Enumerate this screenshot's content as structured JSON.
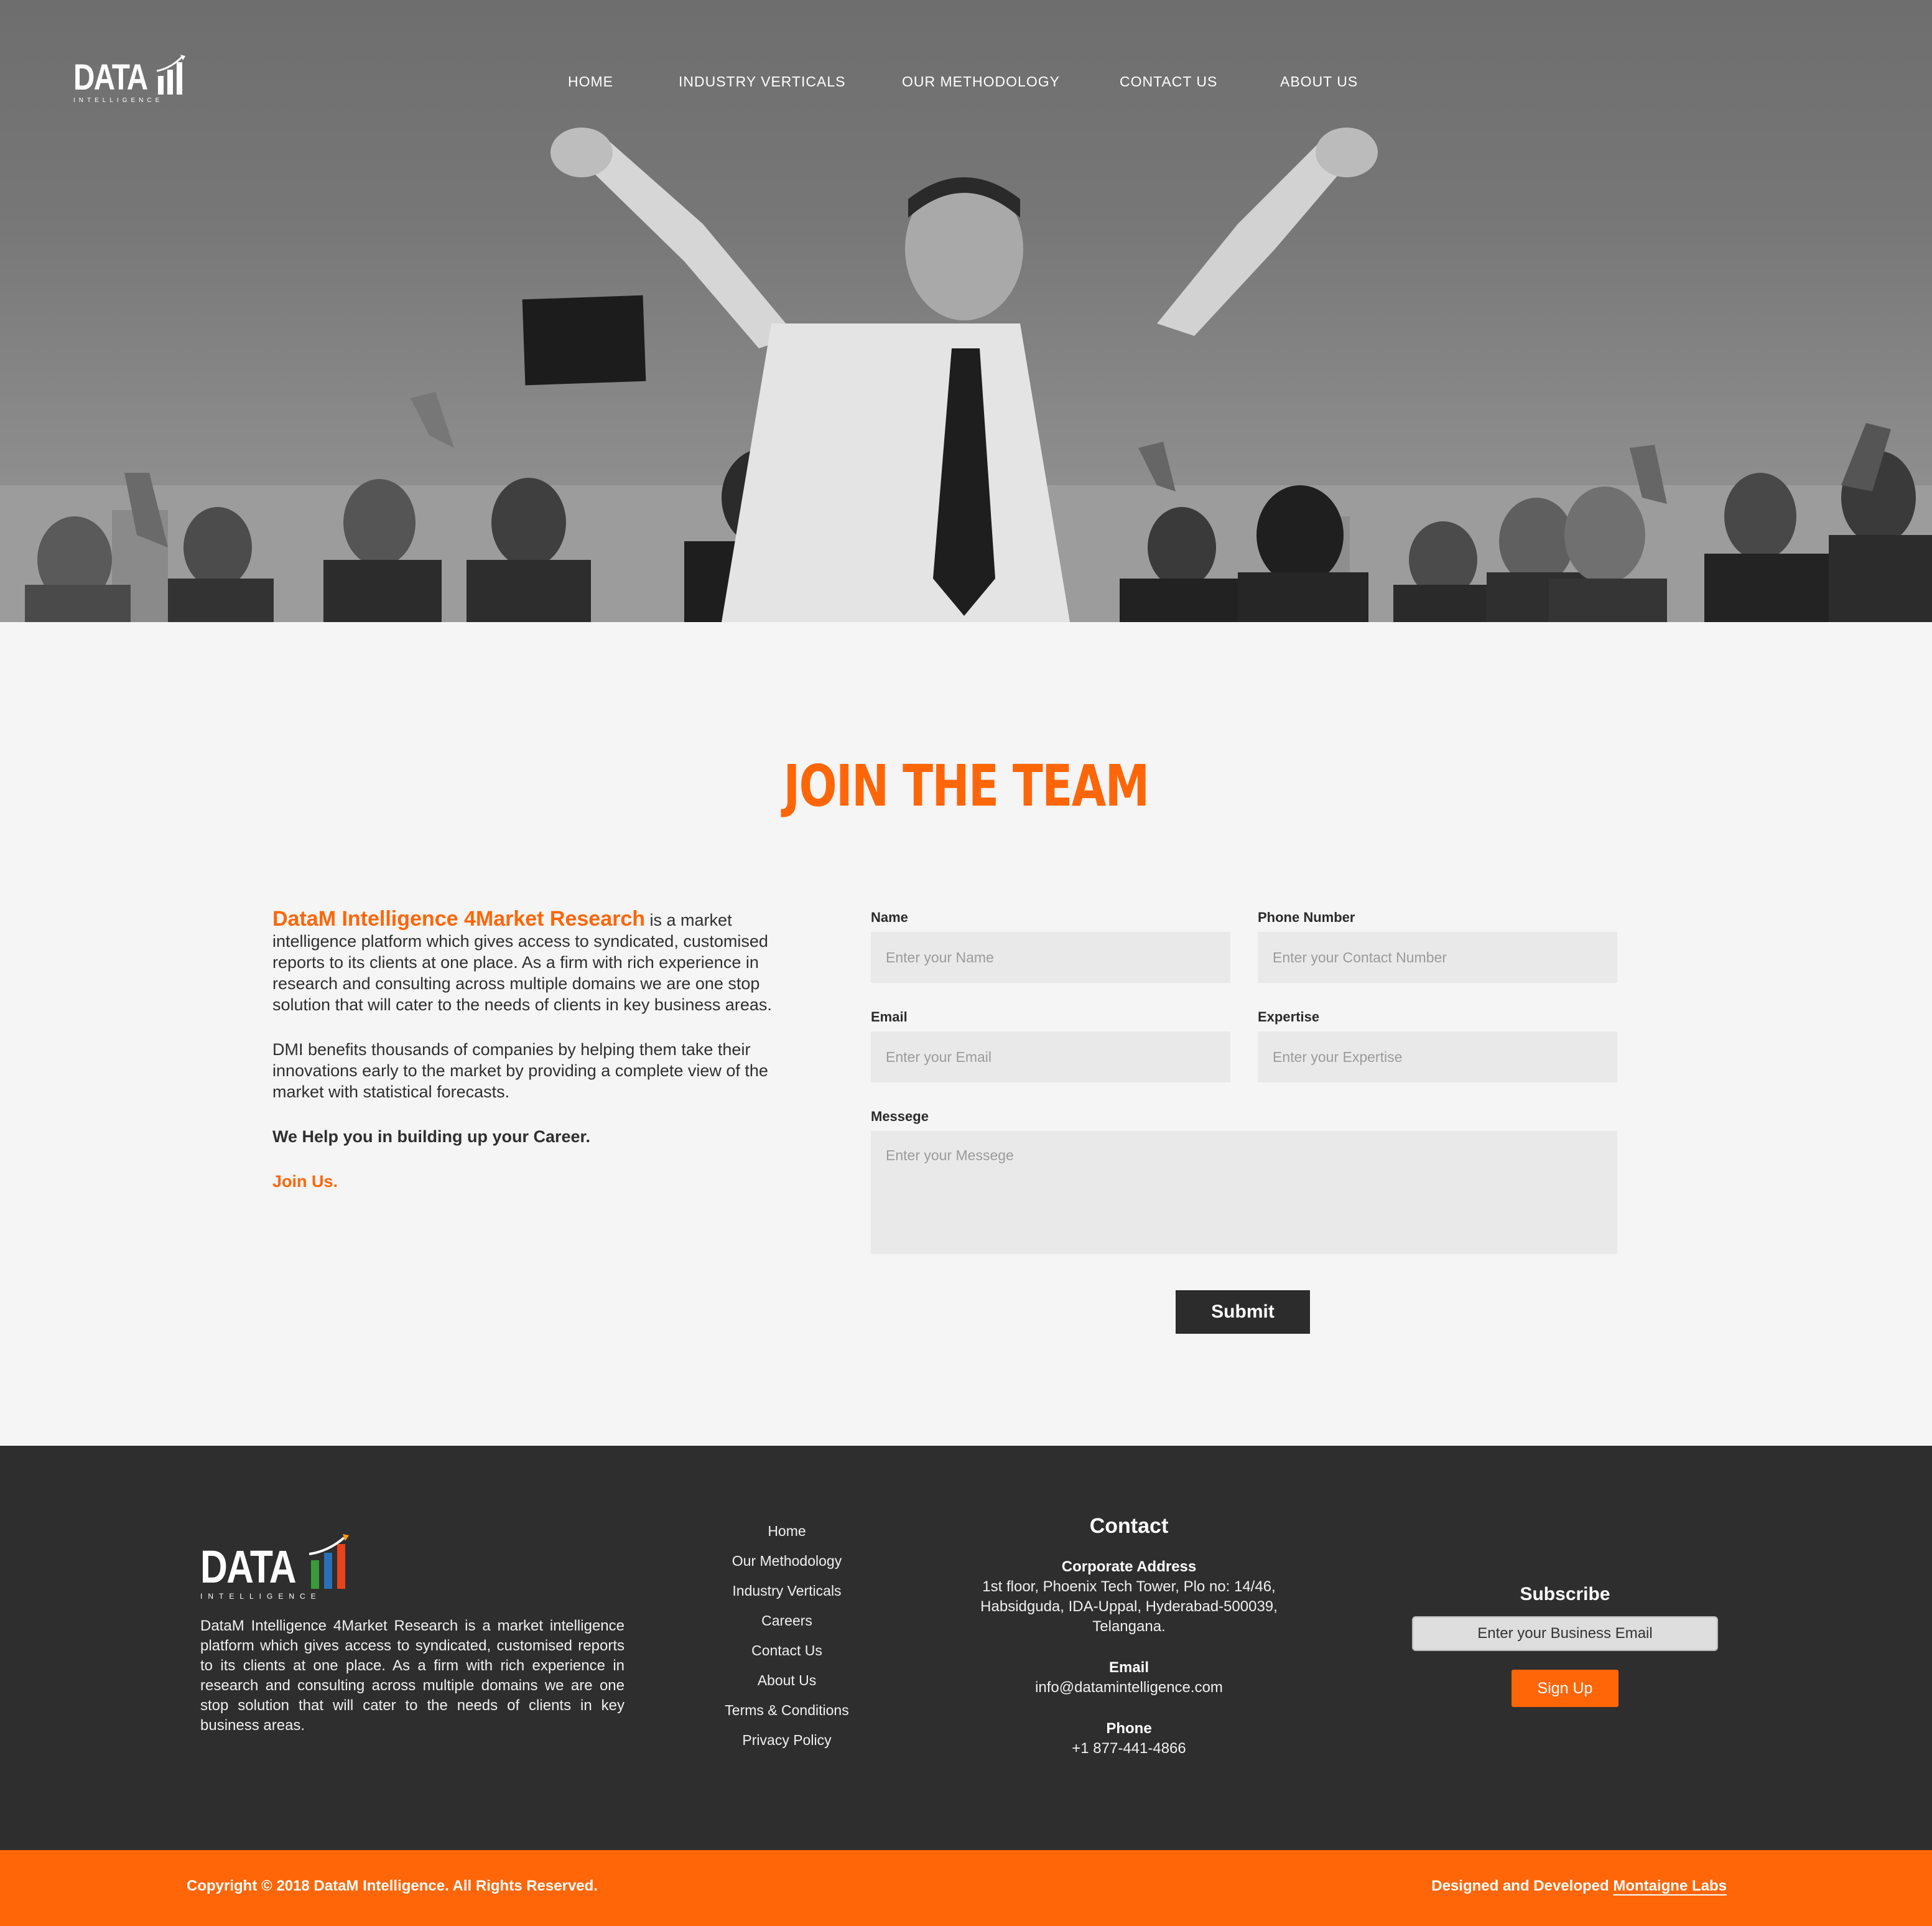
{
  "brand": {
    "logo_word": "DATA",
    "logo_sub": "INTELLIGENCE",
    "accent_color": "#ff6608",
    "dark_color": "#2e2e2e"
  },
  "nav": {
    "items": [
      "HOME",
      "INDUSTRY VERTICALS",
      "OUR METHODOLOGY",
      "CONTACT US",
      "ABOUT US"
    ]
  },
  "join": {
    "title": "JOIN THE TEAM",
    "brand_name": "DataM Intelligence 4Market Research",
    "intro_rest": " is a market intelligence platform which gives access to syndicated, customised reports to its clients at one place. As a firm with rich experience in research and consulting across multiple domains we are one stop solution that will cater to the needs of clients in key business areas.",
    "para2": "DMI benefits thousands of companies by helping them take their innovations early to the market by providing a complete view of the market with statistical forecasts.",
    "tagline": "We Help you in building up your Career.",
    "join_link": "Join Us."
  },
  "form": {
    "name_label": "Name",
    "name_placeholder": "Enter your Name",
    "phone_label": "Phone Number",
    "phone_placeholder": "Enter your Contact Number",
    "email_label": "Email",
    "email_placeholder": "Enter your Email",
    "expertise_label": "Expertise",
    "expertise_placeholder": "Enter your Expertise",
    "message_label": "Messege",
    "message_placeholder": "Enter your Messege",
    "submit_label": "Submit"
  },
  "footer": {
    "about": "DataM Intelligence 4Market Research is a market intelligence platform which gives access to syndicated, customised reports to its clients at one place. As a firm with rich experience in research and consulting across multiple domains we are one stop solution that will cater to the needs of clients in key business areas.",
    "links": [
      "Home",
      "Our Methodology",
      "Industry Verticals",
      "Careers",
      "Contact Us",
      "About Us",
      "Terms & Conditions",
      "Privacy Policy"
    ],
    "contact_title": "Contact",
    "address_label": "Corporate Address",
    "address_line1": "1st floor, Phoenix Tech Tower, Plo no: 14/46,",
    "address_line2": "Habsidguda, IDA-Uppal, Hyderabad-500039,",
    "address_line3": "Telangana.",
    "email_label": "Email",
    "email_value": "info@datamintelligence.com",
    "phone_label": "Phone",
    "phone_value": "+1 877-441-4866",
    "subscribe_title": "Subscribe",
    "subscribe_placeholder": "Enter your Business Email",
    "signup_label": "Sign Up"
  },
  "bottom": {
    "copyright": "Copyright © 2018 DataM Intelligence. All Rights Reserved.",
    "designed_by": "Designed and Developed ",
    "designer_link": "Montaigne Labs"
  }
}
